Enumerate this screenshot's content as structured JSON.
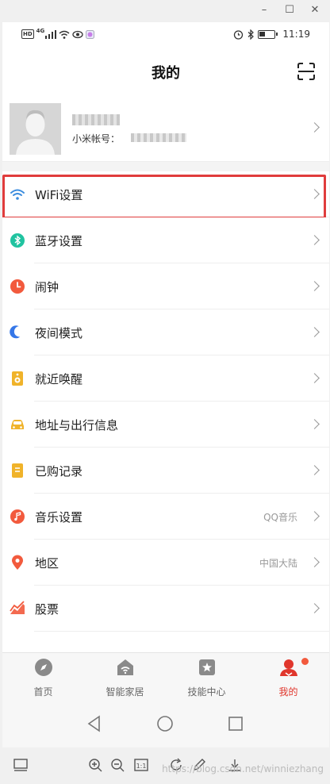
{
  "window": {
    "minimize": "–",
    "maximize": "☐",
    "close": "✕"
  },
  "status": {
    "left_badge": "HD",
    "network": "4G",
    "time": "11:19"
  },
  "header": {
    "title": "我的",
    "scan_icon": "scan-icon"
  },
  "profile": {
    "account_label": "小米帐号："
  },
  "menu": [
    {
      "label": "WiFi设置",
      "value": "",
      "icon": "wifi-icon",
      "color": "#3c8dde",
      "highlight": true
    },
    {
      "label": "蓝牙设置",
      "value": "",
      "icon": "bluetooth-icon",
      "color": "#20c3a0"
    },
    {
      "label": "闹钟",
      "value": "",
      "icon": "alarm-icon",
      "color": "#f25a3d"
    },
    {
      "label": "夜间模式",
      "value": "",
      "icon": "moon-icon",
      "color": "#3577e8"
    },
    {
      "label": "就近唤醒",
      "value": "",
      "icon": "speaker-icon",
      "color": "#f0b32a"
    },
    {
      "label": "地址与出行信息",
      "value": "",
      "icon": "car-icon",
      "color": "#f0b32a"
    },
    {
      "label": "已购记录",
      "value": "",
      "icon": "receipt-icon",
      "color": "#f0b32a"
    },
    {
      "label": "音乐设置",
      "value": "QQ音乐",
      "icon": "music-icon",
      "color": "#f25a3d"
    },
    {
      "label": "地区",
      "value": "中国大陆",
      "icon": "location-icon",
      "color": "#f25a3d"
    },
    {
      "label": "股票",
      "value": "",
      "icon": "stock-icon",
      "color": "#f25a3d"
    }
  ],
  "tabs": [
    {
      "label": "首页",
      "icon": "home-compass-icon",
      "active": false
    },
    {
      "label": "智能家居",
      "icon": "smart-home-icon",
      "active": false
    },
    {
      "label": "技能中心",
      "icon": "skill-star-icon",
      "active": false
    },
    {
      "label": "我的",
      "icon": "profile-icon",
      "active": true
    }
  ],
  "watermark": "https://blog.csdn.net/winniezhang",
  "colors": {
    "accent": "#e0362c",
    "highlight_border": "#e03c3c"
  }
}
